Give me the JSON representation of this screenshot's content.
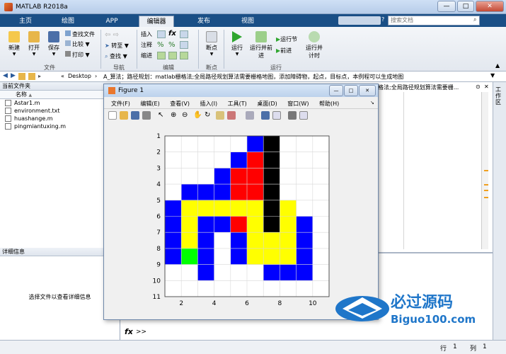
{
  "window": {
    "title": "MATLAB R2018a",
    "min": "—",
    "max": "□",
    "close": "✕"
  },
  "tabs": [
    "主页",
    "绘图",
    "APP",
    "编辑器",
    "发布",
    "视图"
  ],
  "search_placeholder": "搜索文档",
  "ribbon": {
    "file": {
      "new": "新建",
      "open": "打开",
      "save": "保存",
      "find_files": "查找文件",
      "compare": "比较",
      "print": "打印",
      "group": "文件"
    },
    "nav": {
      "goto": "转至",
      "find": "查找",
      "group": "导航"
    },
    "edit": {
      "insert": "插入",
      "comment": "注释",
      "indent": "缩进",
      "fx": "fx",
      "group": "编辑"
    },
    "bp": {
      "breakpoints": "断点",
      "group": "断点"
    },
    "run": {
      "run": "运行",
      "run_adv": "运行并前进",
      "run_section": "运行节",
      "advance": "前进",
      "run_time": "运行并计时",
      "group": "运行"
    }
  },
  "address": {
    "root": "«",
    "path1": "Desktop",
    "sep": "›",
    "path2": "A_算法；路径规划：matlab栅格法;全局路径规划算法需要栅格地图，添加障碍物，起点，目标点，本例程可以生成地图"
  },
  "current_folder": {
    "title": "当前文件夹",
    "col": "名称",
    "sort_icon": "▲",
    "files": [
      "Astar1.m",
      "environment.txt",
      "huashange.m",
      "pingmiantuxing.m"
    ]
  },
  "details": {
    "title": "详细信息",
    "text": "选择文件以查看详细信息"
  },
  "editor_tab": "格法;全局路径规划算法需要栅...",
  "workspace_label": "工作区",
  "command": {
    "fx": "fx",
    "prompt": ">>"
  },
  "status": {
    "row_label": "行",
    "row": "1",
    "col_label": "列",
    "col": "1"
  },
  "figure": {
    "title": "Figure 1",
    "menu": [
      "文件(F)",
      "编辑(E)",
      "查看(V)",
      "插入(I)",
      "工具(T)",
      "桌面(D)",
      "窗口(W)",
      "帮助(H)"
    ]
  },
  "colors": {
    "blue": "#0000ff",
    "red": "#ff0000",
    "yellow": "#ffff00",
    "black": "#000000",
    "green": "#00ff00",
    "white": "#ffffff"
  },
  "chart_data": {
    "type": "heatmap",
    "xlim": [
      1,
      11
    ],
    "ylim": [
      1,
      11
    ],
    "xticks": [
      "2",
      "4",
      "6",
      "8",
      "10"
    ],
    "yticks": [
      "1",
      "2",
      "3",
      "4",
      "5",
      "6",
      "7",
      "8",
      "9",
      "10",
      "11"
    ],
    "grid": true,
    "legend": "K=black obstacle, R=red, B=blue, Y=yellow, G=green, W=white",
    "cells": [
      "WWWWWBKWWW",
      "WWWWBRKWWW",
      "WWWBRRKWWW",
      "WBBBRRKWWW",
      "BYYYYYKYWW",
      "BYBBRYKYBW",
      "BYBWBYYYBW",
      "BGBWBYYYBW",
      "WWBWWWBBBW",
      "WWWWWWWWWW"
    ]
  },
  "watermark": {
    "brand": "必过源码",
    "domain": "Biguo100.com"
  }
}
